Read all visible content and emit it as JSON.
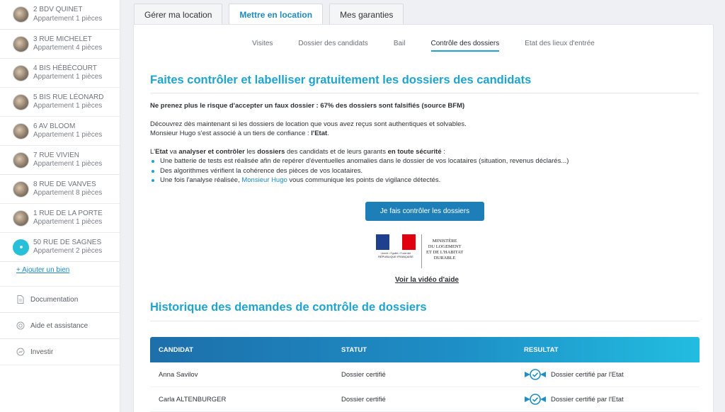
{
  "sidebar": {
    "properties": [
      {
        "name": "2 BDV QUINET",
        "type": "Appartement 1 pièces",
        "avatar": "photo"
      },
      {
        "name": "3 RUE MICHELET",
        "type": "Appartement 4 pièces",
        "avatar": "photo"
      },
      {
        "name": "4 BIS HÉBÉCOURT",
        "type": "Appartement 1 pièces",
        "avatar": "photo"
      },
      {
        "name": "5 BIS RUE LÉONARD",
        "type": "Appartement 1 pièces",
        "avatar": "photo"
      },
      {
        "name": "6 AV BLOOM",
        "type": "Appartement 1 pièces",
        "avatar": "photo"
      },
      {
        "name": "7 RUE VIVIEN",
        "type": "Appartement 1 pièces",
        "avatar": "photo"
      },
      {
        "name": "8 RUE DE VANVES",
        "type": "Appartement 8 pièces",
        "avatar": "photo"
      },
      {
        "name": "1 RUE DE LA PORTE",
        "type": "Appartement 1 pièces",
        "avatar": "photo"
      },
      {
        "name": "50 RUE DE SAGNES",
        "type": "Appartement 2 pièces",
        "avatar": "teal"
      }
    ],
    "add_label": "+ Ajouter un bien",
    "menu": [
      {
        "label": "Documentation",
        "icon": "document-icon"
      },
      {
        "label": "Aide et assistance",
        "icon": "lifebuoy-icon"
      },
      {
        "label": "Investir",
        "icon": "invest-icon"
      }
    ]
  },
  "tabs": [
    {
      "label": "Gérer ma location"
    },
    {
      "label": "Mettre en location"
    },
    {
      "label": "Mes garanties"
    }
  ],
  "subnav": [
    {
      "label": "Visites"
    },
    {
      "label": "Dossier des candidats"
    },
    {
      "label": "Bail"
    },
    {
      "label": "Contrôle des dossiers"
    },
    {
      "label": "Etat des lieux d'entrée"
    }
  ],
  "main": {
    "title": "Faites contrôler et labelliser gratuitement les dossiers des candidats",
    "warning": "Ne prenez plus le risque d'accepter un faux dossier : 67% des dossiers sont falsifiés (source BFM)",
    "intro1": "Découvrez dès maintenant si les dossiers de location que vous avez reçus sont authentiques et solvables.",
    "intro2_a": "Monsieur Hugo s'est associé à un tiers de confiance : ",
    "intro2_b": "l'Etat",
    "intro2_c": ".",
    "etat_a": "L'",
    "etat_b": "Etat",
    "etat_c": " va ",
    "etat_d": "analyser et contrôler",
    "etat_e": " les ",
    "etat_f": "dossiers",
    "etat_g": " des candidats et de leurs garants ",
    "etat_h": "en toute sécurité",
    "etat_i": " :",
    "bullet1": "Une batterie de tests est réalisée afin de repérer d'éventuelles anomalies dans le dossier de vos locataires (situation, revenus déclarés...)",
    "bullet2": "Des algorithmes vérifient la cohérence des pièces de vos locataires.",
    "bullet3_a": "Une fois l'analyse réalisée, ",
    "bullet3_b": "Monsieur Hugo",
    "bullet3_c": " vous communique les points de vigilance détectés.",
    "cta": "Je fais contrôler les dossiers",
    "logo": {
      "motto": "Liberté • Égalité • Fraternité",
      "rep": "RÉPUBLIQUE FRANÇAISE",
      "ministry": [
        "MINISTÈRE",
        "DU LOGEMENT",
        "ET DE L'HABITAT",
        "DURABLE"
      ]
    },
    "video_link": "Voir la vidéo d'aide",
    "history_title": "Historique des demandes de contrôle de dossiers"
  },
  "table": {
    "headers": [
      "CANDIDAT",
      "STATUT",
      "RESULTAT"
    ],
    "rows": [
      {
        "candidat": "Anna Savilov",
        "statut": "Dossier certifié",
        "resultat": "Dossier certifié par l'Etat"
      },
      {
        "candidat": "Carla ALTENBURGER",
        "statut": "Dossier certifié",
        "resultat": "Dossier certifié par l'Etat"
      }
    ]
  },
  "colors": {
    "accent": "#1fa4d0",
    "button": "#1e7fb8",
    "teal": "#28c0d8"
  }
}
